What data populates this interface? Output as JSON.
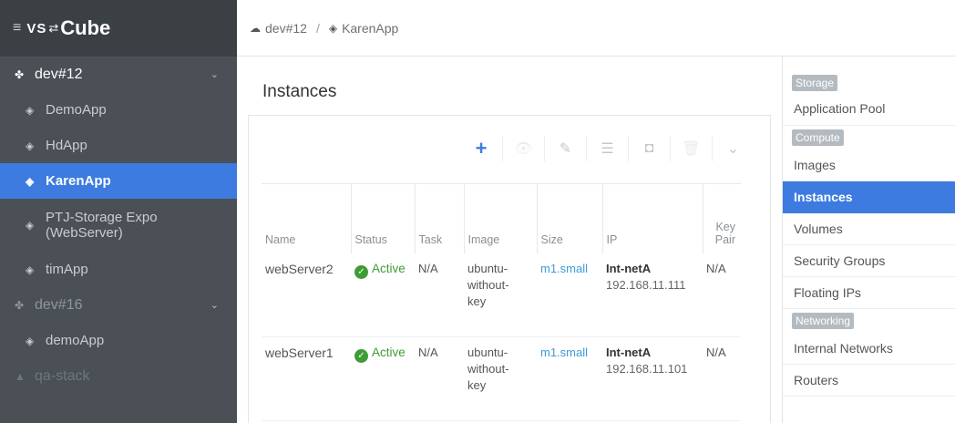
{
  "brand": {
    "menu_icon": "≡",
    "logo_vs": "VS",
    "logo_arrows": "⇄",
    "logo_cube": "Cube"
  },
  "sidebar": {
    "groups": [
      {
        "label": "dev#12",
        "icon": "projects-icon"
      },
      {
        "label": "dev#16",
        "icon": "projects-icon"
      },
      {
        "label": "qa-stack",
        "icon": "warning-icon"
      }
    ],
    "items": [
      {
        "label": "DemoApp"
      },
      {
        "label": "HdApp"
      },
      {
        "label": "KarenApp",
        "active": true
      },
      {
        "label_line1": "PTJ-Storage Expo",
        "label_line2": "(WebServer)"
      },
      {
        "label": "timApp"
      },
      {
        "label": "demoApp"
      }
    ]
  },
  "breadcrumb": {
    "project": "dev#12",
    "separator": "/",
    "app": "KarenApp"
  },
  "main": {
    "title": "Instances",
    "toolbar": {
      "add": "+",
      "view": "👁",
      "edit": "✎",
      "list": "☰",
      "snapshot": "◘",
      "delete": "🗑",
      "more": "⌄"
    },
    "columns": [
      "Name",
      "Status",
      "Task",
      "Image",
      "Size",
      "IP",
      "Key Pair"
    ],
    "rows": [
      {
        "name": "webServer2",
        "status": "Active",
        "task": "N/A",
        "image_l1": "ubuntu-",
        "image_l2": "without-",
        "image_l3": "key",
        "size": "m1.small",
        "net_name": "Int-netA",
        "net_ip": "192.168.11.111",
        "keypair": "N/A"
      },
      {
        "name": "webServer1",
        "status": "Active",
        "task": "N/A",
        "image_l1": "ubuntu-",
        "image_l2": "without-",
        "image_l3": "key",
        "size": "m1.small",
        "net_name": "Int-netA",
        "net_ip": "192.168.11.101",
        "keypair": "N/A"
      }
    ]
  },
  "rpanel": {
    "storage": {
      "badge": "Storage",
      "items": [
        "Application Pool"
      ]
    },
    "compute": {
      "badge": "Compute",
      "items": [
        "Images",
        "Instances",
        "Volumes",
        "Security Groups",
        "Floating IPs"
      ]
    },
    "networking": {
      "badge": "Networking",
      "items": [
        "Internal Networks",
        "Routers"
      ]
    }
  },
  "colors": {
    "accent": "#3d7be0",
    "sidebar_bg": "#4a5055",
    "brand_bg": "#3b4045",
    "active_green": "#3f9c35",
    "flavor_link": "#3d9ad9"
  }
}
